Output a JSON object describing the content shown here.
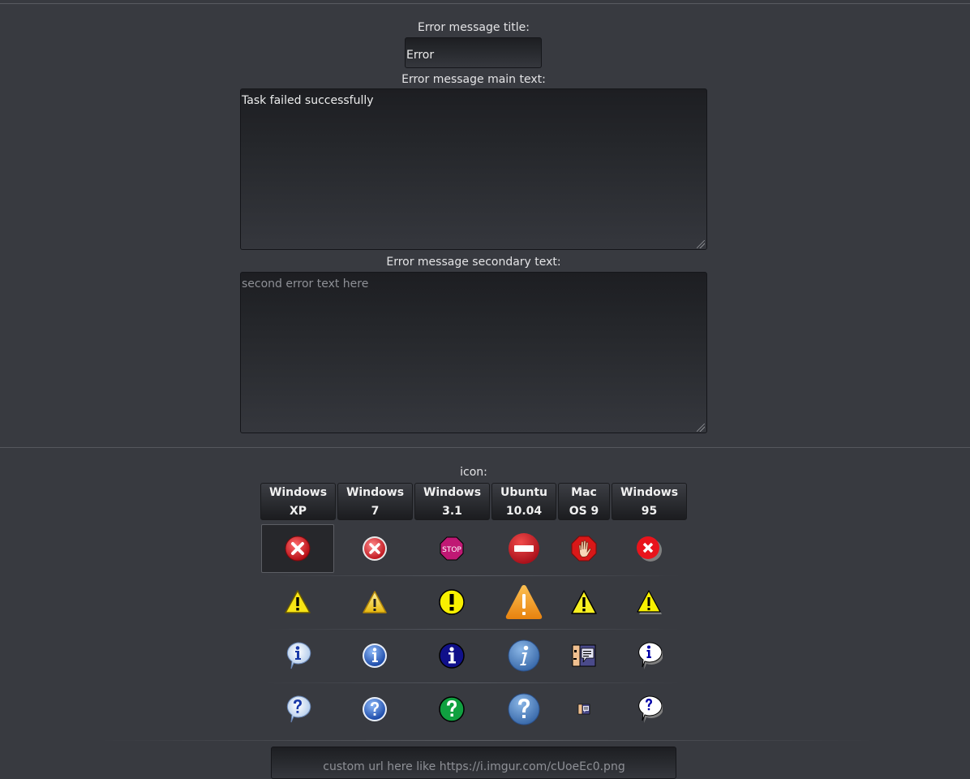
{
  "form": {
    "title_label": "Error message title:",
    "title_value": "Error",
    "main_label": "Error message main text:",
    "main_value": "Task failed successfully",
    "secondary_label": "Error message secondary text:",
    "secondary_value": "",
    "secondary_placeholder": "second error text here"
  },
  "icon_section": {
    "label": "icon:",
    "os_tabs": [
      {
        "line1": "Windows",
        "line2": "XP"
      },
      {
        "line1": "Windows",
        "line2": "7"
      },
      {
        "line1": "Windows",
        "line2": "3.1"
      },
      {
        "line1": "Ubuntu",
        "line2": "10.04"
      },
      {
        "line1": "Mac",
        "line2": "OS 9"
      },
      {
        "line1": "Windows",
        "line2": "95"
      }
    ],
    "rows": [
      "error",
      "warning",
      "info",
      "question"
    ],
    "stop_sign_text": "STOP",
    "selected": {
      "row": "error",
      "os": "Windows XP"
    }
  },
  "custom_url": {
    "value": "",
    "placeholder": "custom url here like https://i.imgur.com/cUoeEc0.png"
  },
  "colors": {
    "background": "#383a40",
    "error_red": "#d42028",
    "warning_yellow": "#f4e21e",
    "info_blue": "#2a4cb8",
    "ubuntu_orange": "#f09a24"
  }
}
